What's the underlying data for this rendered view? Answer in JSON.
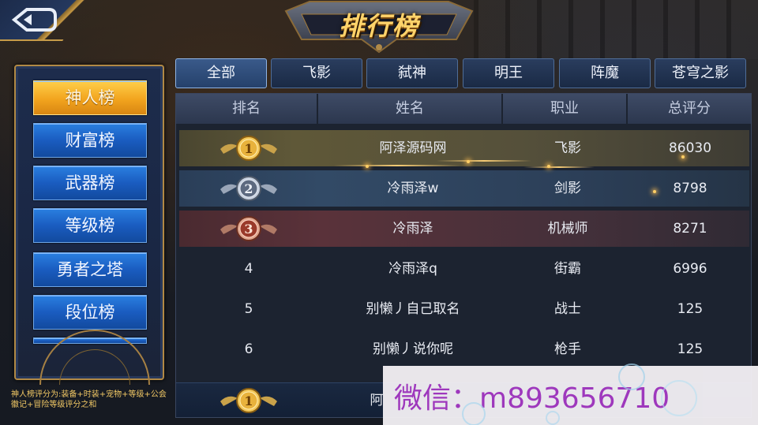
{
  "title": "排行榜",
  "rank_categories": [
    {
      "label": "神人榜",
      "active": true
    },
    {
      "label": "财富榜",
      "active": false
    },
    {
      "label": "武器榜",
      "active": false
    },
    {
      "label": "等级榜",
      "active": false
    },
    {
      "label": "勇者之塔",
      "active": false
    },
    {
      "label": "段位榜",
      "active": false
    }
  ],
  "footnote": "神人榜评分为:装备+时装+宠物+等级+公会徽记+冒险等级评分之和",
  "class_tabs": [
    "全部",
    "飞影",
    "弑神",
    "明王",
    "阵魔",
    "苍穹之影"
  ],
  "table": {
    "headers": [
      "排名",
      "姓名",
      "职业",
      "总评分"
    ],
    "rows": [
      {
        "rank": "1",
        "name": "阿泽源码网",
        "job": "飞影",
        "score": "86030",
        "medal": "gold"
      },
      {
        "rank": "2",
        "name": "冷雨泽w",
        "job": "剑影",
        "score": "8798",
        "medal": "silver"
      },
      {
        "rank": "3",
        "name": "冷雨泽",
        "job": "机械师",
        "score": "8271",
        "medal": "bronze"
      },
      {
        "rank": "4",
        "name": "冷雨泽q",
        "job": "街霸",
        "score": "6996",
        "medal": ""
      },
      {
        "rank": "5",
        "name": "别懒丿自己取名",
        "job": "战士",
        "score": "125",
        "medal": ""
      },
      {
        "rank": "6",
        "name": "别懒丿说你呢",
        "job": "枪手",
        "score": "125",
        "medal": ""
      }
    ],
    "my_row": {
      "rank": "1",
      "name": "阿"
    }
  },
  "watermark": "微信：m893656710",
  "colors": {
    "active_tab": "#f2a41e",
    "tab_blue": "#1a5cc0",
    "gold_text": "#ffd36a",
    "watermark_text": "#a63ac4"
  }
}
